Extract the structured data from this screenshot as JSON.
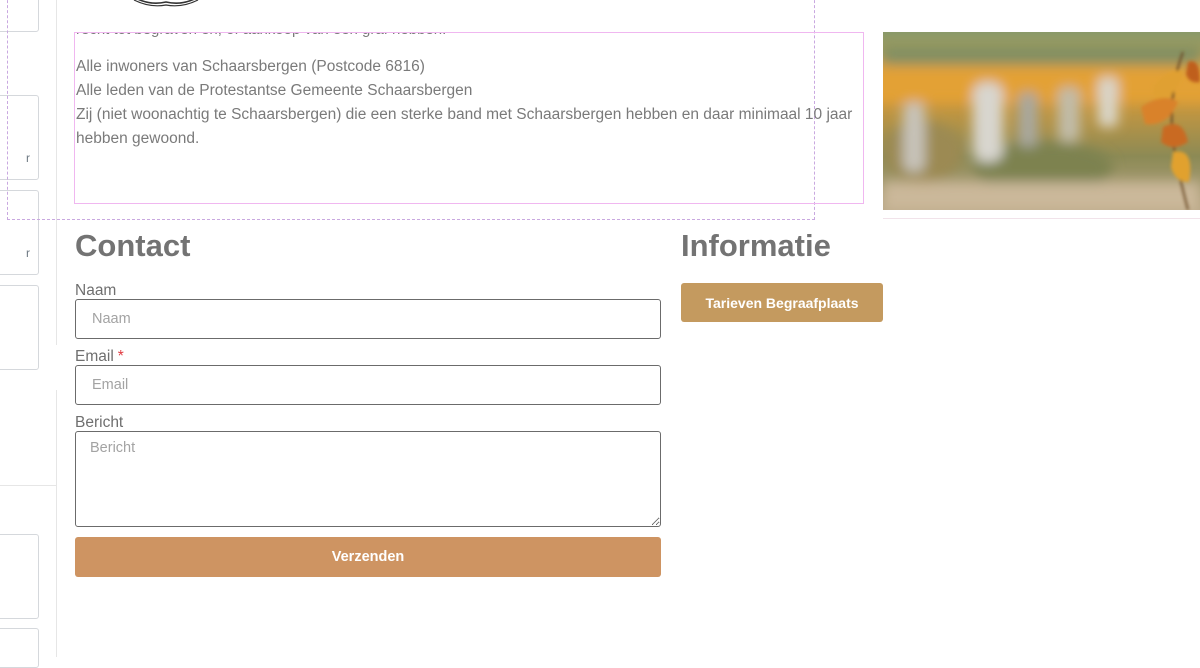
{
  "content": {
    "cut_line": "recht tot begraven en, of aankoop van een graf hebben:",
    "eligibility": [
      "Alle inwoners van Schaarsbergen (Postcode 6816)",
      "Alle leden van de Protestantse Gemeente Schaarsbergen",
      "Zij (niet woonachtig te Schaarsbergen) die een sterke band met Schaarsbergen hebben en daar minimaal 10 jaar hebben gewoond."
    ]
  },
  "contact": {
    "title": "Contact",
    "name_label": "Naam",
    "name_placeholder": "Naam",
    "email_label": "Email",
    "email_required_mark": "*",
    "email_placeholder": "Email",
    "message_label": "Bericht",
    "message_placeholder": "Bericht",
    "submit_label": "Verzenden"
  },
  "info": {
    "title": "Informatie",
    "button_label": "Tarieven Begraafplaats"
  },
  "editor": {
    "panel_glyph_1": "r",
    "panel_glyph_2": "r",
    "collapse_icon": "chevron-left-icon",
    "collapse_glyph": "‹"
  },
  "colors": {
    "submit_button": "#ce9462",
    "info_button": "#c49a5f",
    "heading": "#737373",
    "body_text": "#7a7a7a"
  }
}
